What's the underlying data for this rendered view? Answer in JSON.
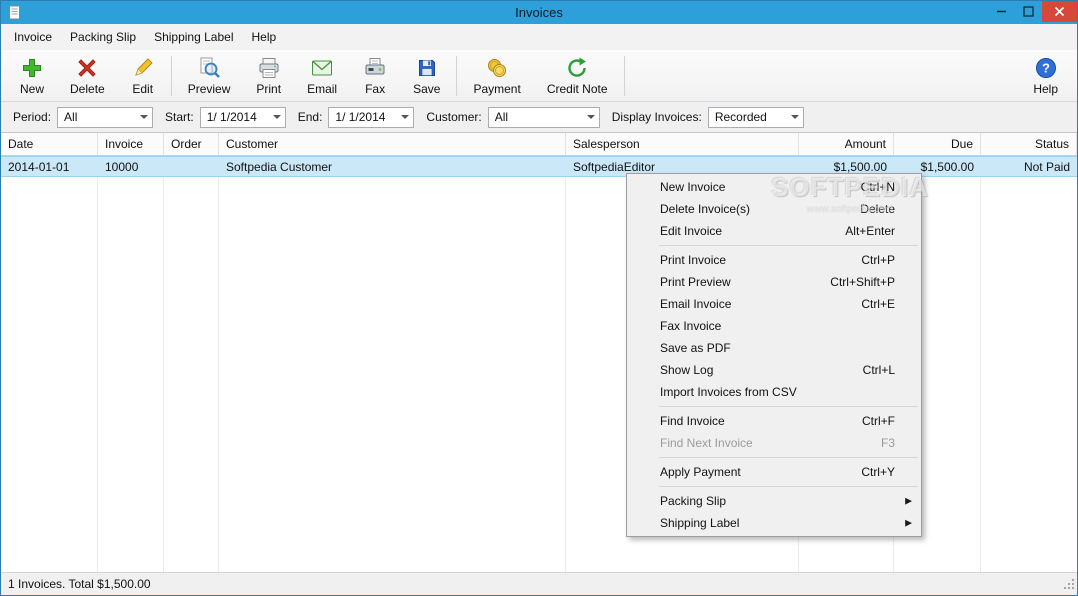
{
  "window": {
    "title": "Invoices"
  },
  "colors": {
    "titlebar_blue": "#2d9fd9",
    "window_border_blue": "#2b7cb0",
    "close_button_red": "#d7473a",
    "selected_row_blue": "#cbe8f8",
    "menu_background": "#f0f0f0"
  },
  "menu_bar": {
    "items": [
      {
        "label": "Invoice"
      },
      {
        "label": "Packing Slip"
      },
      {
        "label": "Shipping Label"
      },
      {
        "label": "Help"
      }
    ]
  },
  "toolbar": {
    "buttons": [
      {
        "label": "New",
        "icon": "new-plus-icon"
      },
      {
        "label": "Delete",
        "icon": "delete-x-icon"
      },
      {
        "label": "Edit",
        "icon": "edit-pencil-icon"
      },
      {
        "label": "Preview",
        "icon": "preview-magnifier-icon"
      },
      {
        "label": "Print",
        "icon": "printer-icon"
      },
      {
        "label": "Email",
        "icon": "email-envelope-icon"
      },
      {
        "label": "Fax",
        "icon": "fax-machine-icon"
      },
      {
        "label": "Save",
        "icon": "save-floppy-icon"
      },
      {
        "label": "Payment",
        "icon": "payment-coins-icon"
      },
      {
        "label": "Credit Note",
        "icon": "credit-note-arrow-icon"
      },
      {
        "label": "Help",
        "icon": "help-question-icon"
      }
    ]
  },
  "filter_bar": {
    "period": {
      "label": "Period:",
      "value": "All"
    },
    "start": {
      "label": "Start:",
      "value": "1/ 1/2014"
    },
    "end": {
      "label": "End:",
      "value": "1/ 1/2014"
    },
    "customer": {
      "label": "Customer:",
      "value": "All"
    },
    "display_invoices": {
      "label": "Display Invoices:",
      "value": "Recorded"
    }
  },
  "table": {
    "columns": [
      {
        "label": "Date"
      },
      {
        "label": "Invoice"
      },
      {
        "label": "Order"
      },
      {
        "label": "Customer"
      },
      {
        "label": "Salesperson"
      },
      {
        "label": "Amount"
      },
      {
        "label": "Due"
      },
      {
        "label": "Status"
      }
    ],
    "rows": [
      {
        "date": "2014-01-01",
        "invoice": "10000",
        "order": "",
        "customer": "Softpedia Customer",
        "salesperson": "SoftpediaEditor",
        "amount": "$1,500.00",
        "due": "$1,500.00",
        "status": "Not Paid"
      }
    ]
  },
  "context_menu": {
    "submenu_arrow": "▶",
    "items": [
      {
        "label": "New Invoice",
        "shortcut": "Ctrl+N"
      },
      {
        "label": "Delete Invoice(s)",
        "shortcut": "Delete"
      },
      {
        "label": "Edit Invoice",
        "shortcut": "Alt+Enter"
      },
      {
        "label": "Print Invoice",
        "shortcut": "Ctrl+P"
      },
      {
        "label": "Print Preview",
        "shortcut": "Ctrl+Shift+P"
      },
      {
        "label": "Email Invoice",
        "shortcut": "Ctrl+E"
      },
      {
        "label": "Fax Invoice",
        "shortcut": ""
      },
      {
        "label": "Save as PDF",
        "shortcut": ""
      },
      {
        "label": "Show Log",
        "shortcut": "Ctrl+L"
      },
      {
        "label": "Import Invoices from CSV",
        "shortcut": ""
      },
      {
        "label": "Find Invoice",
        "shortcut": "Ctrl+F"
      },
      {
        "label": "Find Next Invoice",
        "shortcut": "F3",
        "disabled": true
      },
      {
        "label": "Apply Payment",
        "shortcut": "Ctrl+Y"
      },
      {
        "label": "Packing Slip",
        "submenu": true
      },
      {
        "label": "Shipping Label",
        "submenu": true
      }
    ]
  },
  "status_bar": {
    "text": "1 Invoices. Total $1,500.00"
  },
  "watermark": {
    "line1": "SOFTPEDIA",
    "line2": "www.softpedia.com"
  }
}
